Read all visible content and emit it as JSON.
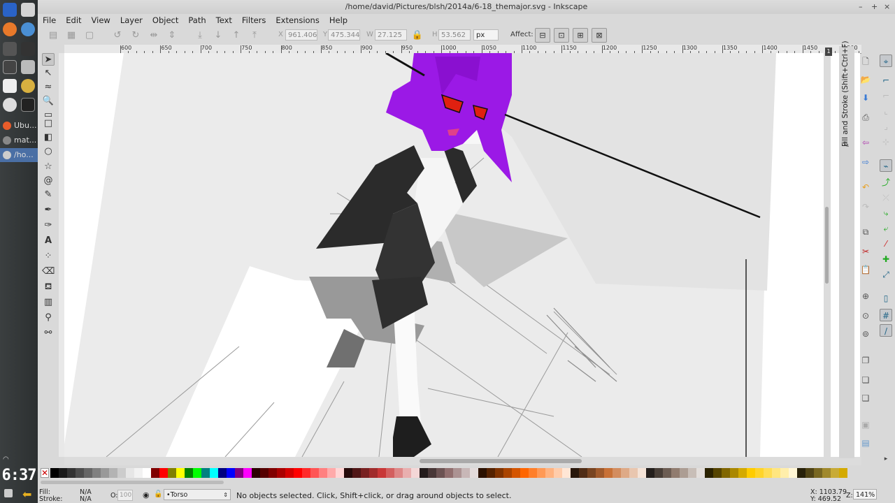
{
  "launcher": {
    "tasks": [
      {
        "label": "Ubu...",
        "color": "#e85c2a"
      },
      {
        "label": "mat...",
        "color": "#888888"
      },
      {
        "label": "/ho...",
        "color": "#4a6fa5"
      }
    ],
    "clock": "6:37"
  },
  "window": {
    "title": "/home/david/Pictures/blsh/2014a/6-18_themajor.svg - Inkscape",
    "controls": [
      "–",
      "+",
      "×"
    ]
  },
  "menu": [
    "File",
    "Edit",
    "View",
    "Layer",
    "Object",
    "Path",
    "Text",
    "Filters",
    "Extensions",
    "Help"
  ],
  "toolctrl": {
    "x_label": "X",
    "x_value": "961.406",
    "y_label": "Y",
    "y_value": "475.344",
    "w_label": "W",
    "w_value": "27.125",
    "h_label": "H",
    "h_value": "53.562",
    "unit": "px",
    "affect_label": "Affect:"
  },
  "ruler": {
    "labels": [
      "600",
      "650",
      "700",
      "750",
      "800",
      "850",
      "900",
      "950",
      "1000",
      "1050",
      "1100",
      "1150",
      "1200",
      "1250",
      "1300",
      "1350",
      "1400",
      "1450",
      "1500"
    ]
  },
  "dock": {
    "label": "Fill and Stroke (Shift+Ctrl+F)",
    "badge": "1"
  },
  "statusbar": {
    "fill_label": "Fill:",
    "fill_value": "N/A",
    "stroke_label": "Stroke:",
    "stroke_value": "N/A",
    "opacity_label": "O:",
    "opacity_value": "100",
    "layer": "•Torso",
    "message": "No objects selected. Click, Shift+click, or drag around objects to select.",
    "x_coord": "X: 1103.79",
    "y_coord": "Y: 469.52",
    "zoom_label": "Z:",
    "zoom": "141%"
  },
  "colors": {
    "hair": "#9b19e6",
    "eyes": "#e02010",
    "jacket": "#2b2b2b",
    "lips": "#e0408a"
  },
  "palette": [
    "#000000",
    "#1a1a1a",
    "#333333",
    "#4d4d4d",
    "#666666",
    "#808080",
    "#999999",
    "#b3b3b3",
    "#cccccc",
    "#e6e6e6",
    "#f2f2f2",
    "#ffffff",
    "#800000",
    "#ff0000",
    "#808000",
    "#ffff00",
    "#008000",
    "#00ff00",
    "#008080",
    "#00ffff",
    "#000080",
    "#0000ff",
    "#800080",
    "#ff00ff",
    "#2b0000",
    "#550000",
    "#800000",
    "#aa0000",
    "#d40000",
    "#ff0000",
    "#ff2a2a",
    "#ff5555",
    "#ff8080",
    "#ffaaaa",
    "#ffd5d5",
    "#280b0b",
    "#501616",
    "#782121",
    "#a02c2c",
    "#c83737",
    "#d35f5f",
    "#de8787",
    "#e9afaf",
    "#f4d7d7",
    "#241c1c",
    "#483737",
    "#6c5353",
    "#916f6f",
    "#ac9393",
    "#c8b7b7",
    "#e3dbdb",
    "#2b1100",
    "#552200",
    "#803300",
    "#aa4400",
    "#d45500",
    "#ff6600",
    "#ff7f2a",
    "#ff9955",
    "#ffb380",
    "#ffccaa",
    "#ffe6d5",
    "#28170b",
    "#502d16",
    "#784421",
    "#a05a2c",
    "#c87137",
    "#d38d5f",
    "#deaa87",
    "#e9c6af",
    "#f4e3d7",
    "#241f1c",
    "#483e37",
    "#6c5d53",
    "#917c6f",
    "#ac9d93",
    "#c8beb7",
    "#e3dedb",
    "#2b2200",
    "#554400",
    "#806600",
    "#aa8800",
    "#d4aa00",
    "#ffcc00",
    "#ffd42a",
    "#ffdd55",
    "#ffe680",
    "#ffeeaa",
    "#fff6d5",
    "#28220b",
    "#504416",
    "#786721",
    "#a0892c",
    "#c8ab37",
    "#d4aa00"
  ]
}
